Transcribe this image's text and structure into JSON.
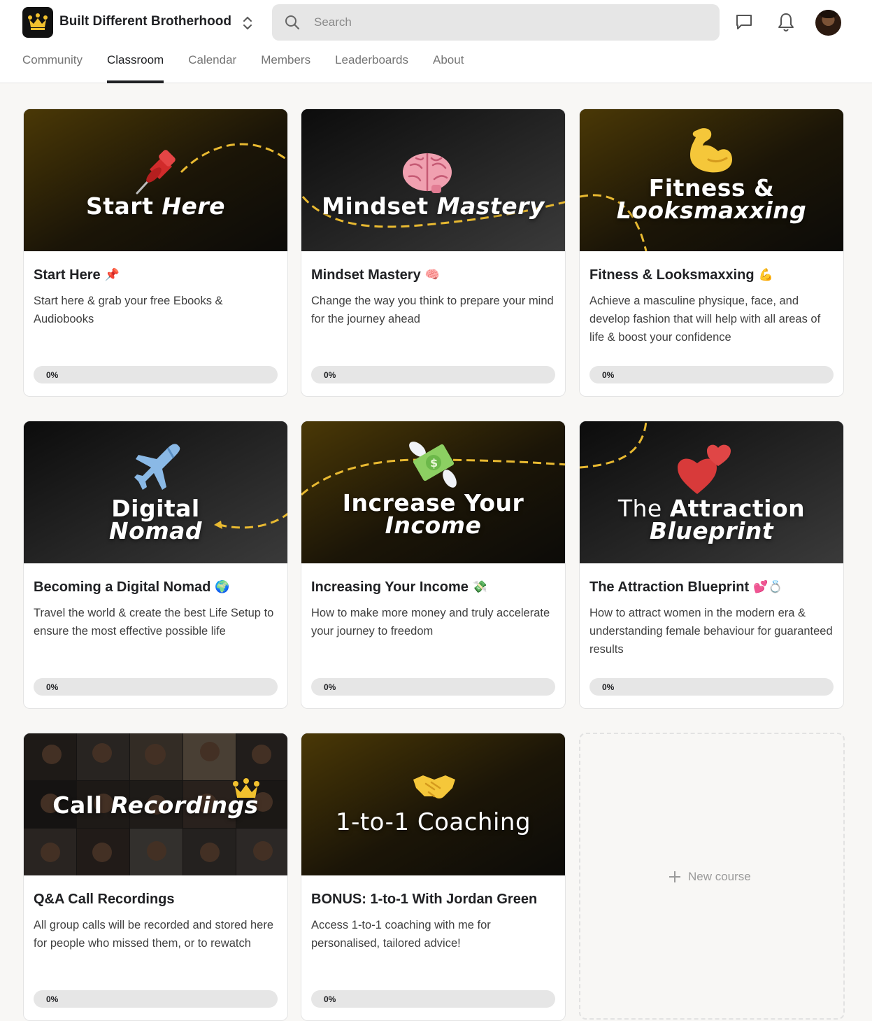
{
  "header": {
    "group_name": "Built Different Brotherhood",
    "search_placeholder": "Search",
    "icons": [
      "crown-logo-icon",
      "switch-community-icon",
      "search-icon",
      "chat-icon",
      "bell-icon",
      "avatar"
    ]
  },
  "tabs": [
    "Community",
    "Classroom",
    "Calendar",
    "Members",
    "Leaderboards",
    "About"
  ],
  "active_tab": "Classroom",
  "courses": [
    {
      "banner_line1": "Start ",
      "banner_line1_b": "Here",
      "title": "Start Here",
      "emoji": "📌",
      "description": "Start here & grab your free Ebooks & Audiobooks",
      "progress": "0%"
    },
    {
      "banner_line1": "Mindset ",
      "banner_line1_b": "Mastery",
      "title": "Mindset Mastery",
      "emoji": "🧠",
      "description": "Change the way you think to prepare your mind for the journey ahead",
      "progress": "0%"
    },
    {
      "banner_line1": "Fitness &",
      "banner_line2": "Looksmaxxing",
      "title": "Fitness & Looksmaxxing",
      "emoji": "💪",
      "description": "Achieve a masculine physique, face, and develop fashion that will help with all areas of life & boost your confidence",
      "progress": "0%"
    },
    {
      "banner_line1": "Digital",
      "banner_line2": "Nomad",
      "title": "Becoming a Digital Nomad",
      "emoji": "🌍",
      "description": "Travel the world & create the best Life Setup to ensure the most effective possible life",
      "progress": "0%"
    },
    {
      "banner_line1": "Increase Your",
      "banner_line2": "Income",
      "title": "Increasing Your Income",
      "emoji": "💸",
      "description": "How to make more money and truly accelerate your journey to freedom",
      "progress": "0%"
    },
    {
      "banner_line1": "The ",
      "banner_line1_b": "Attraction",
      "banner_line2": "Blueprint",
      "title": "The Attraction Blueprint",
      "emoji": "💕💍",
      "description": "How to attract women in the modern era & understanding female behaviour for guaranteed results",
      "progress": "0%"
    },
    {
      "banner_line1": "Call ",
      "banner_line1_b": "Recordings",
      "title": "Q&A Call Recordings",
      "emoji": "",
      "description": "All group calls will be recorded and stored here for people who missed them, or to rewatch",
      "progress": "0%"
    },
    {
      "banner_line1": "1-to-1 Coaching",
      "title": "BONUS: 1-to-1 With Jordan Green",
      "emoji": "",
      "description": "Access 1-to-1 coaching with me for personalised, tailored advice!",
      "progress": "0%"
    }
  ],
  "new_course_label": "New course",
  "colors": {
    "accent_gold": "#e8b931",
    "text": "#202124",
    "muted": "#757575",
    "progress_track": "#e6e6e6"
  }
}
